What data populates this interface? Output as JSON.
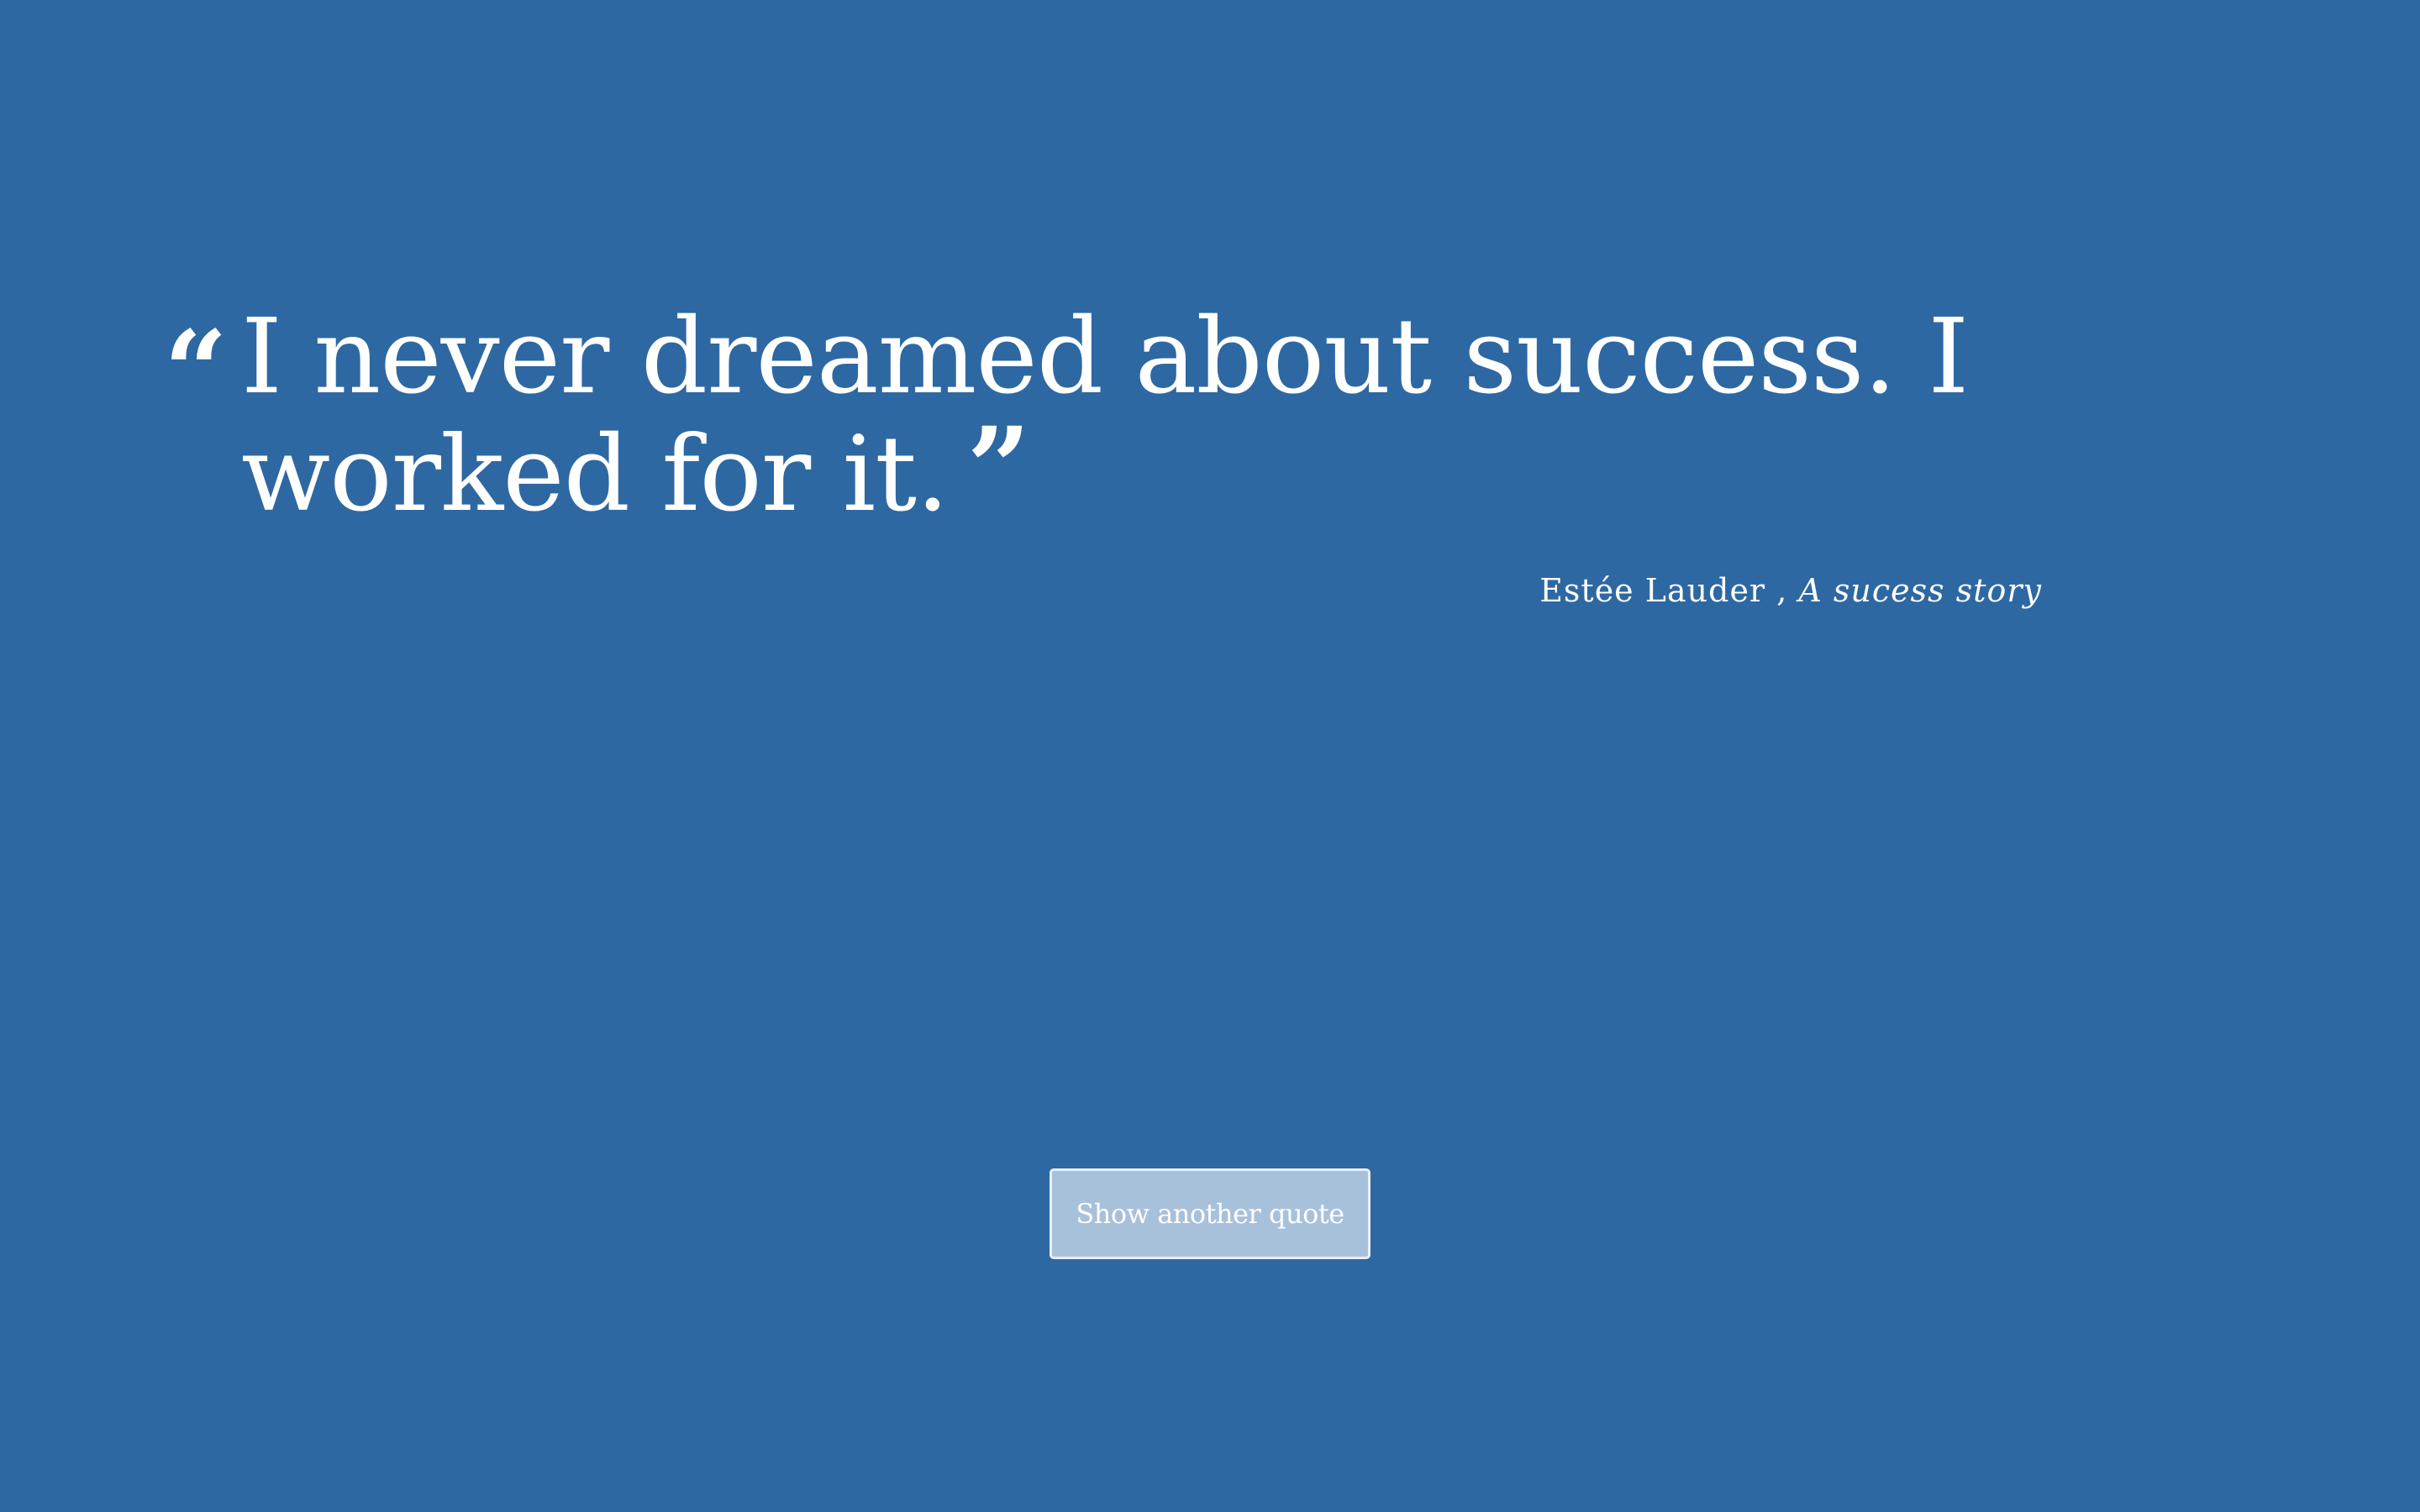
{
  "quote": {
    "open_mark": "“",
    "text": "I never dreamed about success. I worked for it.",
    "close_mark": "”"
  },
  "attribution": {
    "author": "Estée Lauder",
    "separator": " , ",
    "source": "A sucess story"
  },
  "actions": {
    "new_quote_label": "Show another quote"
  },
  "colors": {
    "background": "#2e68a2",
    "text": "#ffffff",
    "button_background": "#a8c1db",
    "button_border": "#e9eff6"
  }
}
